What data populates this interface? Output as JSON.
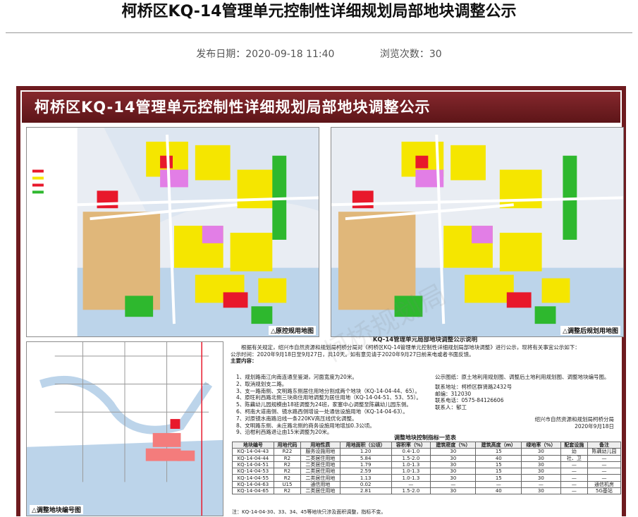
{
  "page": {
    "title": "柯桥区KQ-14管理单元控制性详细规划局部地块调整公示",
    "publish_label": "发布日期：2020-09-18 11:40",
    "views_label": "浏览次数：30"
  },
  "poster": {
    "banner_title": "柯桥区KQ-14管理单元控制性详细规划局部地块调整公示",
    "map1_caption": "△原控规用地图",
    "map2_caption": "△调整后规划用地图",
    "map3_caption": "△调整地块编号图",
    "notice_title": "KQ-14管理单元局部地块调整公示说明",
    "intro": "根据有关规定，绍兴市自然资源和规划局柯桥分局对《柯桥区KQ-14管理单元控制性详细规划局部地块调整》进行公示，现将有关事宜公示如下：",
    "period": "公示时间：2020年9月18日至9月27日，共10天。如有意见请于2020年9月27日前来电或者书面反馈。",
    "main_heading": "主要内容：",
    "items": [
      "1、规划路南江向南连通至鉴湖，河面宽度为20米。",
      "2、取消规划支二路。",
      "3、支一路南侧、文明路东侧居住用地分割成两个地块（KQ-14-04-44、65）。",
      "4、原旺利西路北侧三块商住用地调整为居住用地（KQ-14-04-51、53、55）。",
      "5、陈藕幼儿园规模由18班调整为24班，家塞中心调整至陈藕幼儿园东侧。",
      "6、柯南大道南侧、镜水路西侧增设一处通信设施用地（KQ-14-04-63）。",
      "7、对原镜水南路沿线一条220KV高压线优化调整。",
      "8、文明路东侧、未庄路北侧的商务设施用地增加0.3公顷。",
      "9、沿柑利西路退让由15米调整为20米。"
    ],
    "material": "公示图纸：原土地利用规划图、调整后土地利用规划图、调整地块编号图。",
    "contact_heading": "联系地址：柯桥区群贤路2432号",
    "postcode": "邮编：312030",
    "phone": "联系电话：0575-84126606",
    "person": "联系人：郁工",
    "signature": "绍兴市自然资源和规划局柯桥分局",
    "sign_date": "2020年9月18日",
    "table_caption": "调整地块控制指标一览表",
    "table_note": "注：KQ-14-04-30、33、34、45等地块只涉及面积调整，指标不变。",
    "table_headers": [
      "地块编号",
      "用地代码",
      "用地性质",
      "用地面积（公顷）",
      "容积率（%）",
      "建筑密度（%）",
      "建筑高度（m）",
      "绿地率（%）",
      "配套设施",
      "备注"
    ],
    "table_rows": [
      [
        "KQ-14-04-43",
        "R22",
        "服务设施用地",
        "1.20",
        "0.4-1.0",
        "30",
        "15",
        "30",
        "幼",
        "陈藕幼儿园"
      ],
      [
        "KQ-14-04-44",
        "R2",
        "二类居住用地",
        "5.84",
        "1.5-2.0",
        "30",
        "40",
        "30",
        "社、卫",
        "—"
      ],
      [
        "KQ-14-04-51",
        "R2",
        "二类居住用地",
        "1.79",
        "1.0-1.3",
        "30",
        "15",
        "30",
        "—",
        "—"
      ],
      [
        "KQ-14-04-53",
        "R2",
        "二类居住用地",
        "2.59",
        "1.0-1.3",
        "30",
        "15",
        "30",
        "—",
        "—"
      ],
      [
        "KQ-14-04-55",
        "R2",
        "二类居住用地",
        "1.13",
        "1.0-1.3",
        "30",
        "15",
        "30",
        "—",
        "—"
      ],
      [
        "KQ-14-04-63",
        "U15",
        "通信用地",
        "0.02",
        "—",
        "—",
        "—",
        "—",
        "—",
        "通信机房"
      ],
      [
        "KQ-14-04-65",
        "R2",
        "二类居住用地",
        "2.81",
        "1.5-2.0",
        "30",
        "40",
        "30",
        "—",
        "5G基站"
      ]
    ]
  },
  "colors": {
    "banner": "#6e1b1f",
    "residential": "#f5e600",
    "park": "#2eb82e",
    "water": "#bcd4ea",
    "commercial": "#e8182b",
    "facility": "#e27ee6",
    "industrial": "#e0b77a"
  }
}
